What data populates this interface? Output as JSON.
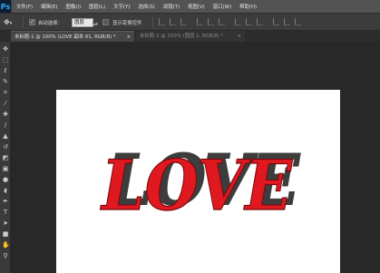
{
  "app": {
    "logo": "Ps"
  },
  "menu": [
    "文件(F)",
    "编辑(E)",
    "图像(I)",
    "图层(L)",
    "文字(Y)",
    "选择(S)",
    "滤镜(T)",
    "视图(V)",
    "窗口(W)",
    "帮助(H)"
  ],
  "options": {
    "move_tool_icon": "move-icon",
    "auto_select_label": "自动选择：",
    "auto_select_checked": true,
    "auto_select_value": "图层",
    "show_transform_label": "显示变换控件",
    "show_transform_checked": false
  },
  "tabs": [
    {
      "label": "未标题-1 @ 100% (LOVE 副本 61, RGB/8) *",
      "close": "×",
      "active": true
    },
    {
      "label": "未标题-2 @ 100% (图层 1, RGB/8) *",
      "close": "×",
      "active": false
    }
  ],
  "tools": [
    "move-icon",
    "marquee-icon",
    "lasso-icon",
    "quick-select-icon",
    "crop-icon",
    "eyedropper-icon",
    "healing-icon",
    "brush-icon",
    "stamp-icon",
    "history-brush-icon",
    "eraser-icon",
    "gradient-icon",
    "blur-icon",
    "dodge-icon",
    "pen-icon",
    "type-icon",
    "path-select-icon",
    "shape-icon",
    "hand-icon",
    "zoom-icon"
  ],
  "canvas": {
    "text": "LOVE",
    "colors": {
      "face": "#e01820",
      "shadow": "#3d3d3d",
      "background": "#ffffff"
    }
  }
}
